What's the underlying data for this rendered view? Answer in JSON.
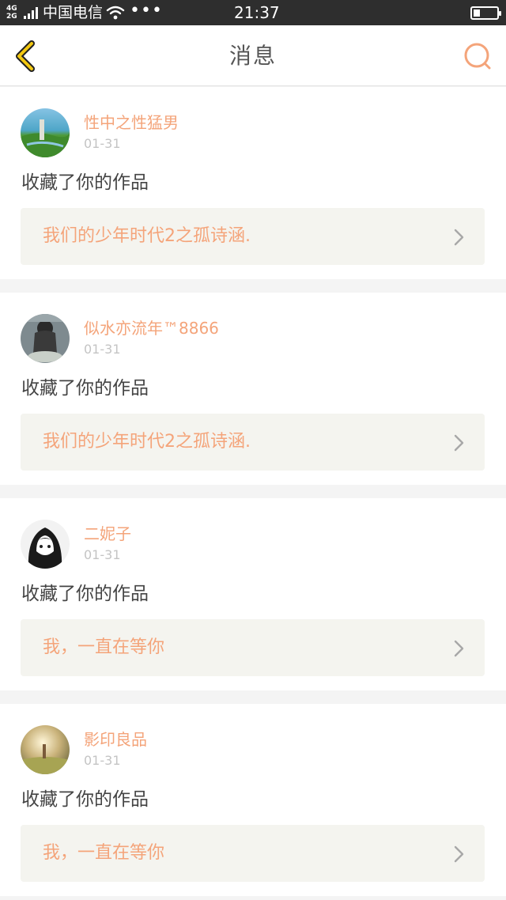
{
  "status_bar": {
    "network": [
      "4G",
      "2G"
    ],
    "carrier": "中国电信",
    "more": "•••",
    "time": "21:37",
    "battery_level": 0.3
  },
  "header": {
    "title": "消息",
    "back_icon": "chevron-left-icon",
    "search_icon": "search-icon",
    "accent_color": "#f4a47a",
    "back_color": "#f2c811"
  },
  "messages": [
    {
      "username": "性中之性猛男",
      "date": "01-31",
      "action": "收藏了你的作品",
      "work_title": "我们的少年时代2之孤诗涵."
    },
    {
      "username": "似水亦流年™8866",
      "date": "01-31",
      "action": "收藏了你的作品",
      "work_title": "我们的少年时代2之孤诗涵."
    },
    {
      "username": "二妮子",
      "date": "01-31",
      "action": "收藏了你的作品",
      "work_title": "我，一直在等你"
    },
    {
      "username": "影印良品",
      "date": "01-31",
      "action": "收藏了你的作品",
      "work_title": "我，一直在等你"
    }
  ]
}
